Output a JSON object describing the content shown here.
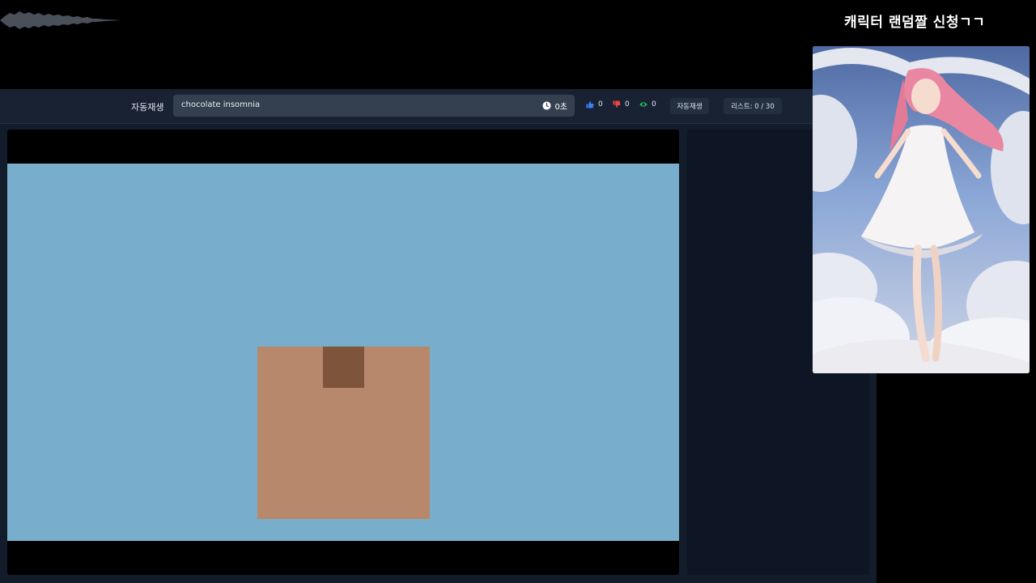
{
  "overlay": {
    "title": "캐릭터 랜덤짤 신청ㄱㄱ"
  },
  "toolbar": {
    "autoplay_label": "자동재생",
    "search_value": "chocolate insomnia",
    "timer": "0초",
    "likes": "0",
    "dislikes": "0",
    "views": "0",
    "autoplay_button": "자동재생",
    "list_counter": "리스트: 0 / 30"
  },
  "icons": {
    "clock": "clock-icon",
    "like": "thumbs-up-icon",
    "dislike": "thumbs-down-icon",
    "views": "eye-icon"
  },
  "colors": {
    "like": "#3b82f6",
    "dislike": "#ef4444",
    "views": "#22c55e",
    "video_sky": "#78aecb",
    "box": "#b7886b",
    "box_tape": "#7e543b"
  }
}
